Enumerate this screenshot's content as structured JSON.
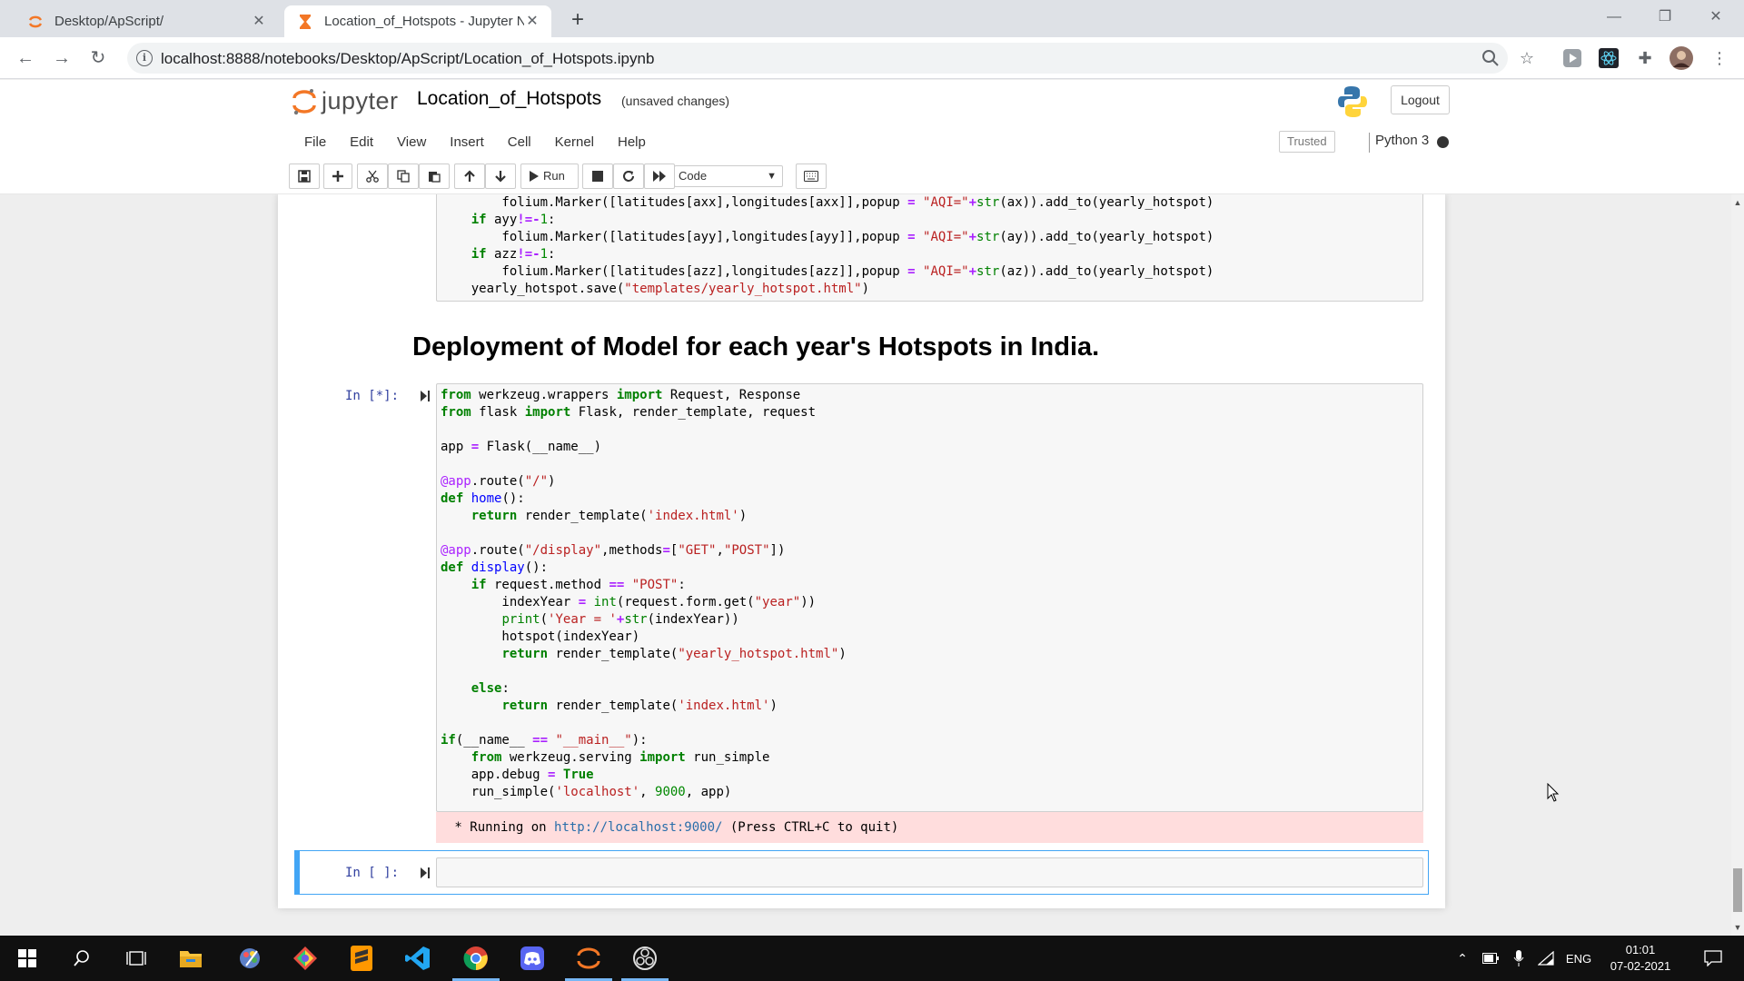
{
  "browser": {
    "tabs": [
      {
        "title": "Desktop/ApScript/",
        "active": false
      },
      {
        "title": "Location_of_Hotspots - Jupyter N",
        "active": true
      }
    ],
    "url": "localhost:8888/notebooks/Desktop/ApScript/Location_of_Hotspots.ipynb"
  },
  "jupyter": {
    "logo_text": "jupyter",
    "notebook_name": "Location_of_Hotspots",
    "save_status": "(unsaved changes)",
    "logout_label": "Logout",
    "menu": [
      "File",
      "Edit",
      "View",
      "Insert",
      "Cell",
      "Kernel",
      "Help"
    ],
    "trusted_label": "Trusted",
    "kernel_name": "Python 3",
    "toolbar": {
      "run_label": "Run",
      "cell_type": "Code"
    }
  },
  "notebook": {
    "heading": "Deployment of Model for each year's Hotspots in India.",
    "cell1_prompt": "In [*]:",
    "output_prefix": " * Running on ",
    "output_link": "http://localhost:9000/",
    "output_suffix": " (Press CTRL+C to quit)",
    "cell2_prompt": "In [ ]:"
  },
  "taskbar": {
    "apps": [
      "start",
      "search",
      "task-view",
      "file-explorer",
      "paint-3d",
      "git-kraken",
      "sublime-text",
      "vscode",
      "chrome",
      "discord",
      "jupyter",
      "obs"
    ],
    "language": "ENG",
    "time": "01:01",
    "date": "07-02-2021"
  },
  "colors": {
    "selected_cell": "#42a5f5",
    "stderr_bg": "#ffdddd",
    "jupyter_orange": "#f37726"
  }
}
